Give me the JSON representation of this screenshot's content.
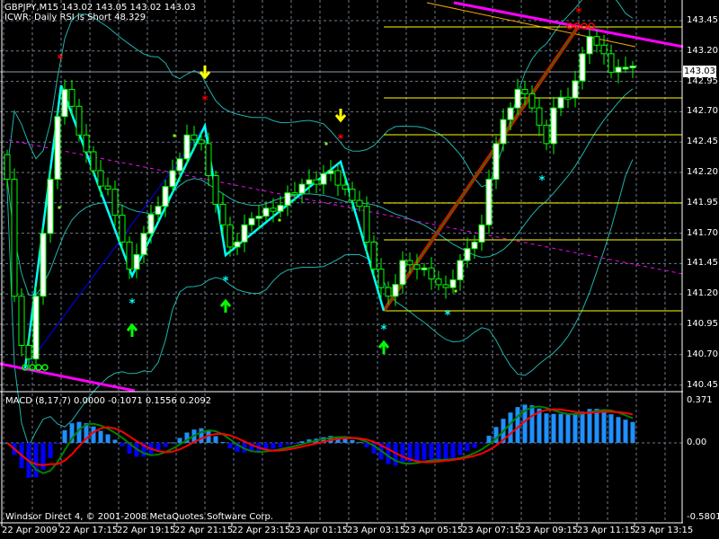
{
  "header": {
    "symbol_line": "GBPJPY,M15  143.02 143.05 143.02 143.03",
    "indicator_line": "ICWR: Daily RSI is Short 48.329"
  },
  "current_price": "143.03",
  "price_axis": [
    "143.45",
    "143.20",
    "142.95",
    "142.70",
    "142.45",
    "142.20",
    "141.95",
    "141.70",
    "141.45",
    "141.20",
    "140.95",
    "140.70",
    "140.45"
  ],
  "macd": {
    "label": "MACD  (8,17,7) 0.0000 -0.1071 0.1556 0.2092",
    "axis": [
      "0.371",
      "0.00",
      "-0.5801"
    ]
  },
  "copyright": "Windsor Direct 4, © 2001-2008 MetaQuotes Software Corp.",
  "time_axis": [
    "22 Apr 2009",
    "22 Apr 17:15",
    "22 Apr 19:15",
    "22 Apr 21:15",
    "22 Apr 23:15",
    "23 Apr 01:15",
    "23 Apr 03:15",
    "23 Apr 05:15",
    "23 Apr 07:15",
    "23 Apr 09:15",
    "23 Apr 11:15",
    "23 Apr 13:15"
  ],
  "price_keypoints": [
    [
      0,
      142.11
    ],
    [
      1,
      141.16
    ],
    [
      2,
      140.76
    ],
    [
      3,
      140.65
    ],
    [
      4,
      141.16
    ],
    [
      5,
      141.67
    ],
    [
      6,
      142.11
    ],
    [
      7,
      142.62
    ],
    [
      8,
      142.84
    ],
    [
      10,
      142.47
    ],
    [
      12,
      142.18
    ],
    [
      14,
      142.03
    ],
    [
      16,
      141.6
    ],
    [
      17,
      141.38
    ],
    [
      19,
      141.67
    ],
    [
      21,
      141.89
    ],
    [
      23,
      142.18
    ],
    [
      25,
      142.47
    ],
    [
      27,
      142.4
    ],
    [
      28,
      142.14
    ],
    [
      30,
      141.74
    ],
    [
      31,
      141.56
    ],
    [
      33,
      141.74
    ],
    [
      35,
      141.81
    ],
    [
      37,
      141.85
    ],
    [
      39,
      142.0
    ],
    [
      41,
      142.07
    ],
    [
      43,
      142.07
    ],
    [
      45,
      142.18
    ],
    [
      47,
      142.03
    ],
    [
      49,
      141.89
    ],
    [
      50,
      141.6
    ],
    [
      51,
      141.38
    ],
    [
      52,
      141.23
    ],
    [
      53,
      141.16
    ],
    [
      55,
      141.45
    ],
    [
      57,
      141.38
    ],
    [
      59,
      141.3
    ],
    [
      61,
      141.23
    ],
    [
      63,
      141.45
    ],
    [
      65,
      141.6
    ],
    [
      66,
      141.74
    ],
    [
      67,
      142.11
    ],
    [
      68,
      142.4
    ],
    [
      70,
      142.69
    ],
    [
      71,
      142.84
    ],
    [
      73,
      142.69
    ],
    [
      74,
      142.55
    ],
    [
      75,
      142.4
    ],
    [
      76,
      142.69
    ],
    [
      78,
      142.77
    ],
    [
      79,
      142.91
    ],
    [
      80,
      143.13
    ],
    [
      81,
      143.27
    ],
    [
      82,
      143.2
    ],
    [
      83,
      143.13
    ],
    [
      84,
      142.98
    ],
    [
      85,
      143.02
    ],
    [
      86,
      143.02
    ],
    [
      87,
      143.03
    ]
  ],
  "colors": {
    "candle_outline": "#00ff00",
    "bull_body": "#ffffff",
    "bear_body": "#000000",
    "grid": "#6e7b8b",
    "bands": "#20b2aa",
    "zigzag": "#00ffff",
    "levels": "#ffff00",
    "trend_magenta": "#ff00ff",
    "trend_orange": "#ffa500",
    "hist_pos": "#1e90ff",
    "hist_neg": "#0000ff",
    "macd_green": "#008000",
    "macd_red": "#ff0000"
  }
}
